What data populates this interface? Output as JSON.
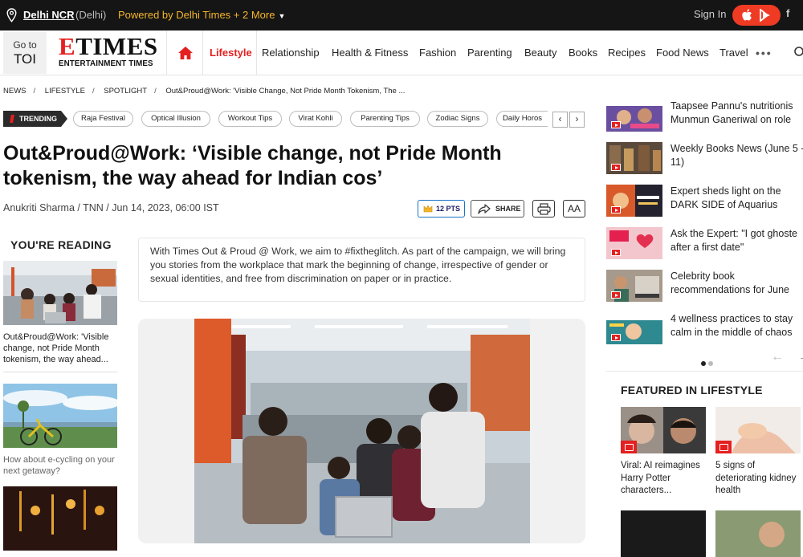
{
  "topbar": {
    "city": "Delhi NCR",
    "city_sub": "(Delhi)",
    "powered": "Powered by Delhi Times + 2 More",
    "signin": "Sign In",
    "facebook": "f"
  },
  "nav": {
    "goto_line1": "Go to",
    "goto_line2": "TOI",
    "brand_e": "E",
    "brand_rest": "TIMES",
    "brand_sub": "ENTERTAINMENT TIMES",
    "items": [
      "Lifestyle",
      "Relationship",
      "Health & Fitness",
      "Fashion",
      "Parenting",
      "Beauty",
      "Books",
      "Recipes",
      "Food News",
      "Travel"
    ],
    "more": "•••"
  },
  "breadcrumb": [
    "NEWS",
    "LIFESTYLE",
    "SPOTLIGHT",
    "Out&Proud@Work: 'Visible Change, Not Pride Month Tokenism, The ..."
  ],
  "trending": {
    "label": "TRENDING",
    "items": [
      "Raja Festival",
      "Optical Illusion",
      "Workout Tips",
      "Virat Kohli",
      "Parenting Tips",
      "Zodiac Signs",
      "Daily Horos"
    ],
    "prev": "‹",
    "next": "›"
  },
  "article": {
    "headline": "Out&Proud@Work: ‘Visible change, not Pride Month tokenism, the way ahead for Indian cos’",
    "byline": "Anukriti Sharma / TNN / Jun 14, 2023, 06:00 IST",
    "points": "12 PTS",
    "share": "SHARE",
    "font_size_btn": "AA",
    "summary": "With Times Out & Proud @ Work, we aim to #fixtheglitch. As part of the campaign, we will bring you stories from the workplace that mark the beginning of change, irrespective of gender or sexual identities, and free from discrimination on paper or in practice."
  },
  "youre_reading": {
    "title": "YOU'RE READING",
    "items": [
      "Out&Proud@Work: 'Visible change, not Pride Month tokenism, the way ahead...",
      "How about e-cycling on your next getaway?"
    ]
  },
  "right_videos": [
    "Taapsee Pannu's nutritionist Munmun Ganeriwal on role",
    "Weekly Books News (June 5 - 11)",
    "Expert sheds light on the DARK SIDE of Aquarius",
    "Ask the Expert: \"I got ghosted after a first date\"",
    "Celebrity book recommendations for June",
    "4 wellness practices to stay calm in the middle of chaos"
  ],
  "right_video_lines": [
    [
      "Taapsee Pannu's nutritionis",
      "Munmun Ganeriwal on role"
    ],
    [
      "Weekly Books News (June 5 -",
      "11)"
    ],
    [
      "Expert sheds light on the",
      "DARK SIDE of Aquarius"
    ],
    [
      "Ask the Expert: \"I got ghoste",
      "after a first date\""
    ],
    [
      "Celebrity book",
      "recommendations for June"
    ],
    [
      "4 wellness practices to stay",
      "calm in the middle of chaos"
    ]
  ],
  "featured": {
    "title": "FEATURED IN LIFESTYLE",
    "items": [
      "Viral: AI reimagines Harry Potter characters...",
      "5 signs of deteriorating kidney health"
    ]
  },
  "colors": {
    "accent": "#e42020",
    "topbar": "#151515",
    "powered": "#f5b52a",
    "pts_border": "#1a73c7"
  },
  "icons": [
    "location-pin-icon",
    "chevron-down-icon",
    "apple-icon",
    "play-store-icon",
    "home-icon",
    "search-icon",
    "crown-icon",
    "share-icon",
    "print-icon",
    "play-icon",
    "arrow-left-icon",
    "arrow-right-icon",
    "photo-icon"
  ]
}
